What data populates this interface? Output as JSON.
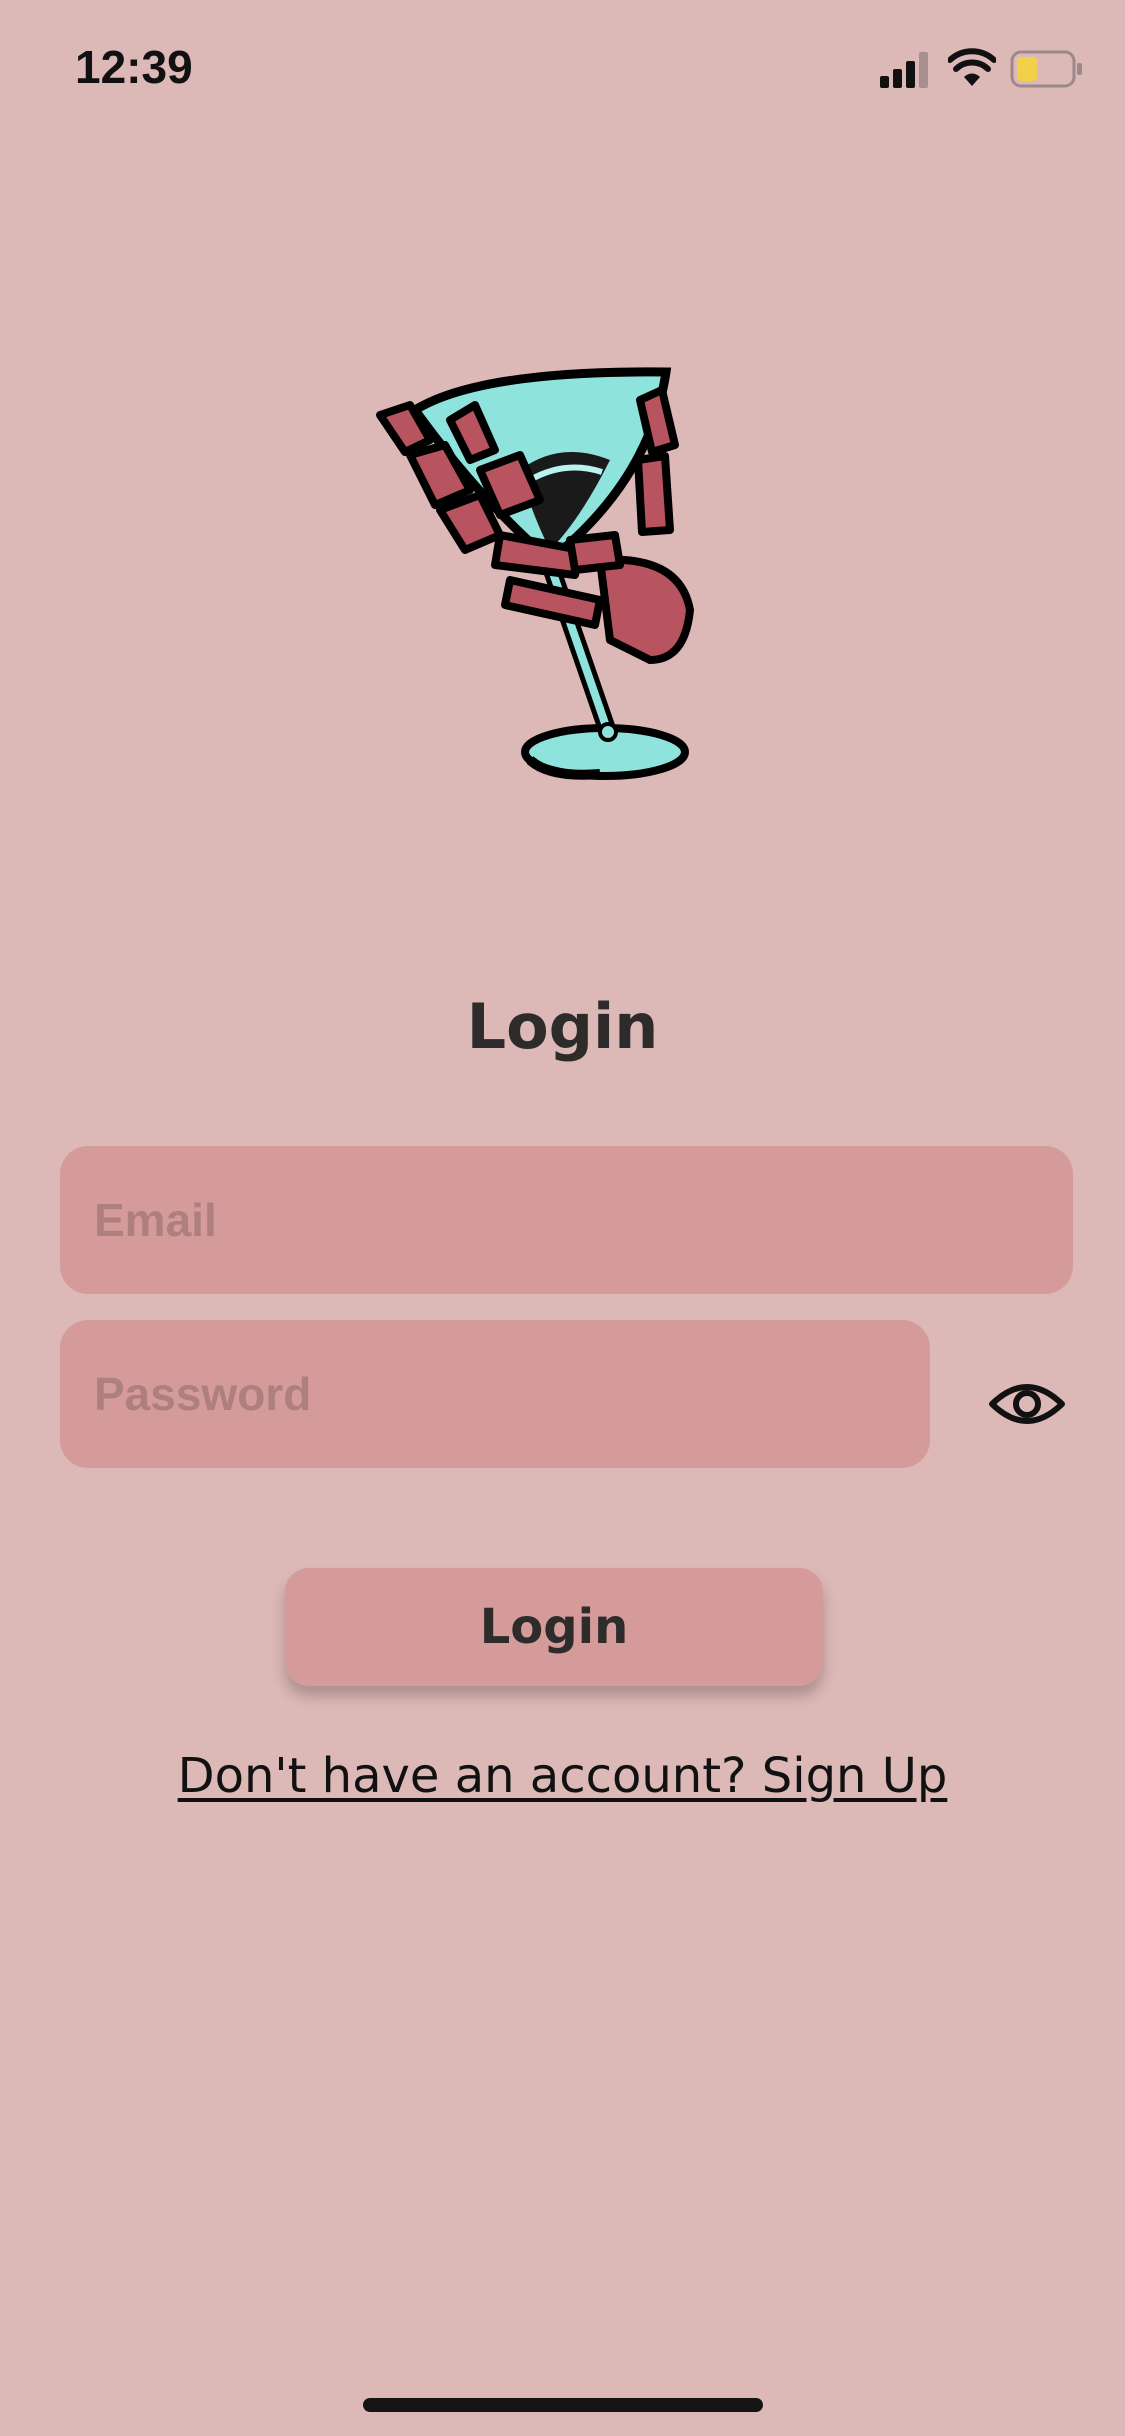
{
  "status_bar": {
    "time": "12:39",
    "signal_icon": "cellular-signal-icon",
    "wifi_icon": "wifi-icon",
    "battery_icon": "battery-low-icon",
    "battery_color": "#f2d04a"
  },
  "logo": {
    "icon": "skeleton-hand-martini-glass-logo"
  },
  "login_form": {
    "title": "Login",
    "email_placeholder": "Email",
    "password_placeholder": "Password",
    "toggle_visibility_icon": "eye-icon",
    "login_button_label": "Login",
    "signup_link_text": "Don't have an account? Sign Up"
  },
  "colors": {
    "background": "#dcb8b7",
    "field_background": "#d49b9a",
    "placeholder": "#ad7f7e",
    "text": "#2e2b2b"
  }
}
